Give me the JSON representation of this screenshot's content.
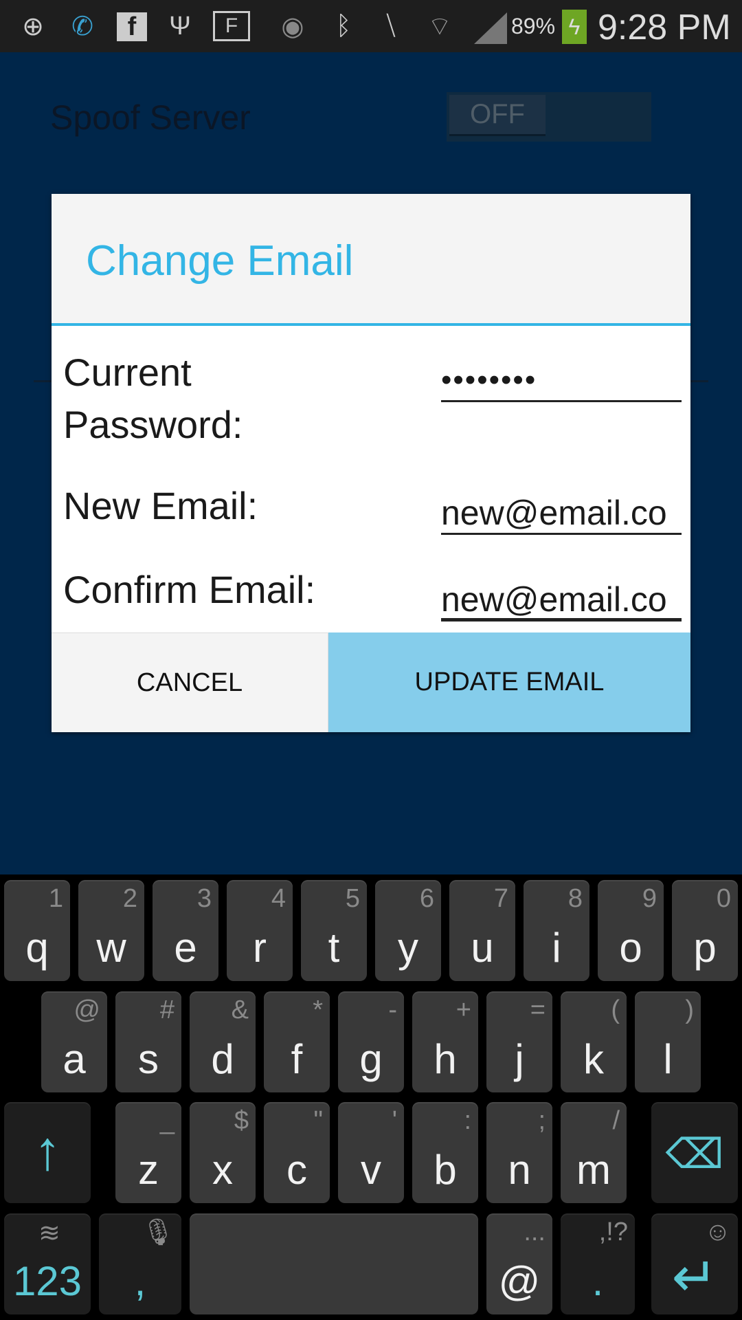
{
  "status_bar": {
    "battery": "89%",
    "time": "9:28 PM",
    "icons": [
      "add-icon",
      "wifi-call-icon",
      "facebook-icon",
      "usb-icon",
      "f-icon",
      "eye-icon",
      "bluetooth-icon",
      "mute-icon",
      "wifi-icon",
      "signal-icon",
      "battery-charging-icon"
    ]
  },
  "background": {
    "setting_label": "Spoof Server",
    "toggle_state": "OFF"
  },
  "dialog": {
    "title": "Change Email",
    "fields": [
      {
        "label": "Current Password:",
        "value": "••••••••"
      },
      {
        "label": "New Email:",
        "value": "new@email.co"
      },
      {
        "label": "Confirm Email:",
        "value": "new@email.co"
      }
    ],
    "cancel_label": "CANCEL",
    "confirm_label": "UPDATE EMAIL"
  },
  "keyboard": {
    "row1": [
      [
        "q",
        "1"
      ],
      [
        "w",
        "2"
      ],
      [
        "e",
        "3"
      ],
      [
        "r",
        "4"
      ],
      [
        "t",
        "5"
      ],
      [
        "y",
        "6"
      ],
      [
        "u",
        "7"
      ],
      [
        "i",
        "8"
      ],
      [
        "o",
        "9"
      ],
      [
        "p",
        "0"
      ]
    ],
    "row2": [
      [
        "a",
        "@"
      ],
      [
        "s",
        "#"
      ],
      [
        "d",
        "&"
      ],
      [
        "f",
        "*"
      ],
      [
        "g",
        "-"
      ],
      [
        "h",
        "+"
      ],
      [
        "j",
        "="
      ],
      [
        "k",
        "("
      ],
      [
        "l",
        ")"
      ]
    ],
    "row3": [
      [
        "z",
        "_"
      ],
      [
        "x",
        "$"
      ],
      [
        "c",
        "\""
      ],
      [
        "v",
        "'"
      ],
      [
        "b",
        ":"
      ],
      [
        "n",
        ";"
      ],
      [
        "m",
        "/"
      ]
    ],
    "numbers_label": "123",
    "comma": ",",
    "at": "@",
    "at_hint": "...",
    "period": ".",
    "period_hint": ",!?"
  },
  "colors": {
    "accent": "#33b5e5",
    "confirm_bg": "#85cdeb",
    "keyboard_accent": "#5bc8d4"
  }
}
